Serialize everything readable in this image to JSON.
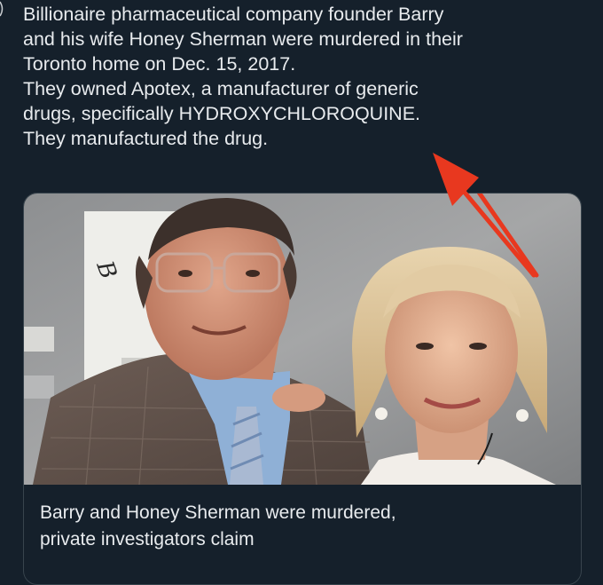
{
  "tweet": {
    "lines": [
      "Billionaire pharmaceutical company founder Barry",
      "and his wife Honey Sherman were murdered in their",
      "Toronto home on Dec. 15, 2017.",
      "They owned Apotex, a manufacturer of generic",
      "drugs, specifically HYDROXYCHLOROQUINE.",
      "They manufactured the drug."
    ]
  },
  "card": {
    "title_lines": [
      "Barry and Honey Sherman were murdered,",
      "private investigators claim"
    ],
    "source": "",
    "photo_alt": "Photo of Barry and Honey Sherman"
  },
  "colors": {
    "background": "#15202b",
    "text": "#e7e9ea",
    "border": "#38444d",
    "arrow": "#e8381f"
  },
  "icons": {
    "annotation": "red-arrow-icon"
  }
}
